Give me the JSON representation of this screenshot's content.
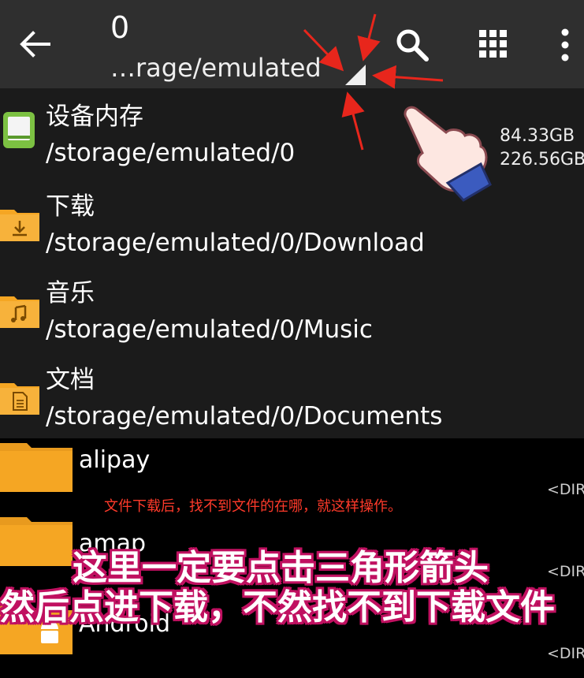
{
  "header": {
    "title": "0",
    "path": "…rage/emulated"
  },
  "dropdown": {
    "items": [
      {
        "name": "设备内存",
        "path": "/storage/emulated/0",
        "icon": "sdcard-icon"
      },
      {
        "name": "下载",
        "path": "/storage/emulated/0/Download",
        "icon": "download-folder-icon"
      },
      {
        "name": "音乐",
        "path": "/storage/emulated/0/Music",
        "icon": "music-folder-icon"
      },
      {
        "name": "文档",
        "path": "/storage/emulated/0/Documents",
        "icon": "document-folder-icon"
      }
    ],
    "storage_free": "84.33GB",
    "storage_total": "226.56GB"
  },
  "files": [
    {
      "name": "alipay",
      "tag": "<DIR>"
    },
    {
      "name": "amap",
      "tag": "<DIR>"
    },
    {
      "name": "Android",
      "tag": "<DIR>"
    }
  ],
  "annotations": {
    "note": "文件下载后，找不到文件的在哪，就这样操作。",
    "caption_line1": "这里一定要点击三角形箭头",
    "caption_line2": "然后点进下载，不然找不到下载文件"
  },
  "colors": {
    "toolbar": "#2f2f2f",
    "dropdown": "#1b1b1b",
    "folder": "#f5a623",
    "sdcard": "#7cc142",
    "arrow_red": "#e8261c",
    "caption_outline": "#c01060"
  }
}
